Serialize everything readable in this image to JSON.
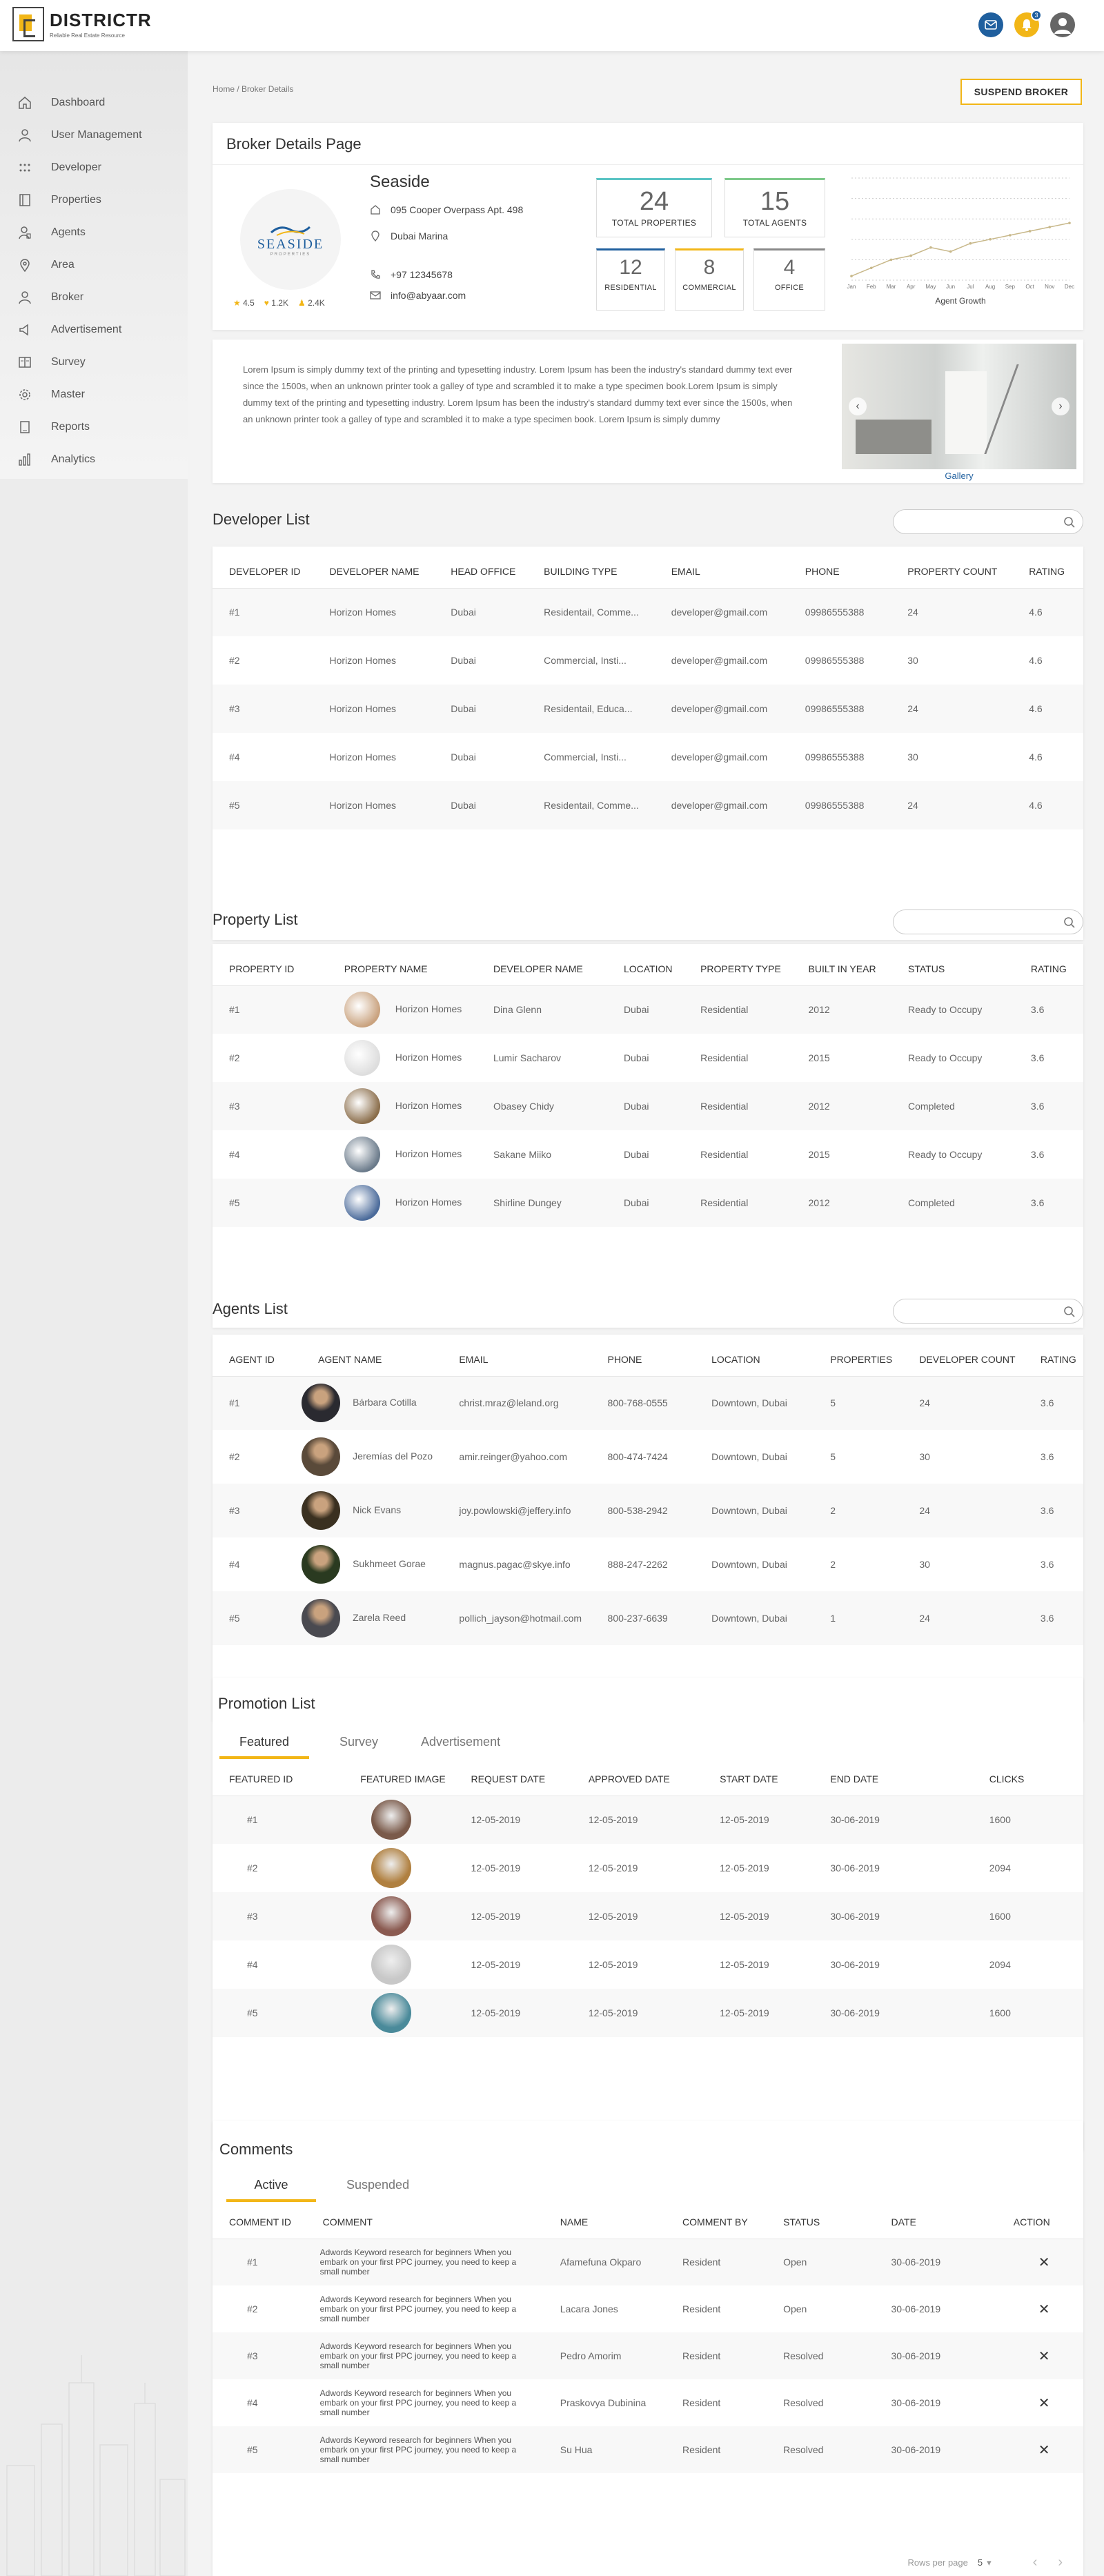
{
  "app": {
    "name": "DISTRICTR",
    "tagline": "Reliable Real Estate Resource",
    "notif_count": "3"
  },
  "nav": [
    "Dashboard",
    "User Management",
    "Developer",
    "Properties",
    "Agents",
    "Area",
    "Broker",
    "Advertisement",
    "Survey",
    "Master",
    "Reports",
    "Analytics"
  ],
  "breadcrumb": "Home / Broker Details",
  "suspend_label": "SUSPEND BROKER",
  "broker": {
    "page_title": "Broker Details Page",
    "name": "Seaside",
    "logo_text": "SEASIDE",
    "logo_sub": "PROPERTIES",
    "address": "095 Cooper Overpass Apt. 498",
    "area": "Dubai Marina",
    "phone": "+97 12345678",
    "email": "info@abyaar.com",
    "rating": "4.5",
    "likes": "1.2K",
    "followers": "2.4K",
    "stats": {
      "total_properties": {
        "value": "24",
        "label": "TOTAL PROPERTIES"
      },
      "total_agents": {
        "value": "15",
        "label": "TOTAL AGENTS"
      },
      "residential": {
        "value": "12",
        "label": "RESIDENTIAL"
      },
      "commercial": {
        "value": "8",
        "label": "COMMERCIAL"
      },
      "office": {
        "value": "4",
        "label": "OFFICE"
      }
    },
    "description": "Lorem Ipsum is simply dummy text of the printing and typesetting industry. Lorem Ipsum has been the industry's standard dummy text ever since the 1500s, when an unknown printer took a galley of type and scrambled it to make a type specimen book.Lorem Ipsum is simply dummy text of the printing and typesetting industry. Lorem Ipsum has been the industry's standard dummy text ever since the 1500s, when an unknown printer took a galley of type and scrambled it to make a type specimen book. Lorem Ipsum is simply dummy",
    "gallery_label": "Gallery"
  },
  "chart_data": {
    "type": "line",
    "title": "Agent Growth",
    "categories": [
      "Jan",
      "Feb",
      "Mar",
      "Apr",
      "May",
      "Jun",
      "Jul",
      "Aug",
      "Sep",
      "Oct",
      "Nov",
      "Dec"
    ],
    "values": [
      2,
      6,
      10,
      12,
      16,
      14,
      18,
      20,
      22,
      24,
      26,
      28
    ],
    "ylim": [
      0,
      50
    ],
    "grid": true
  },
  "developer": {
    "title": "Developer List",
    "columns": [
      "DEVELOPER ID",
      "DEVELOPER NAME",
      "HEAD OFFICE",
      "BUILDING TYPE",
      "EMAIL",
      "PHONE",
      "PROPERTY COUNT",
      "RATING"
    ],
    "rows": [
      [
        "#1",
        "Horizon Homes",
        "Dubai",
        "Residentail, Comme...",
        "developer@gmail.com",
        "09986555388",
        "24",
        "4.6"
      ],
      [
        "#2",
        "Horizon Homes",
        "Dubai",
        "Commercial, Insti...",
        "developer@gmail.com",
        "09986555388",
        "30",
        "4.6"
      ],
      [
        "#3",
        "Horizon Homes",
        "Dubai",
        "Residentail, Educa...",
        "developer@gmail.com",
        "09986555388",
        "24",
        "4.6"
      ],
      [
        "#4",
        "Horizon Homes",
        "Dubai",
        "Commercial, Insti...",
        "developer@gmail.com",
        "09986555388",
        "30",
        "4.6"
      ],
      [
        "#5",
        "Horizon Homes",
        "Dubai",
        "Residentail, Comme...",
        "developer@gmail.com",
        "09986555388",
        "24",
        "4.6"
      ]
    ]
  },
  "property": {
    "title": "Property List",
    "columns": [
      "PROPERTY ID",
      "PROPERTY NAME",
      "DEVELOPER NAME",
      "LOCATION",
      "PROPERTY TYPE",
      "BUILT IN YEAR",
      "STATUS",
      "RATING"
    ],
    "rows": [
      [
        "#1",
        "Horizon Homes",
        "Dina Glenn",
        "Dubai",
        "Residential",
        "2012",
        "Ready to Occupy",
        "3.6"
      ],
      [
        "#2",
        "Horizon Homes",
        "Lumir Sacharov",
        "Dubai",
        "Residential",
        "2015",
        "Ready to Occupy",
        "3.6"
      ],
      [
        "#3",
        "Horizon Homes",
        "Obasey Chidy",
        "Dubai",
        "Residential",
        "2012",
        "Completed",
        "3.6"
      ],
      [
        "#4",
        "Horizon Homes",
        "Sakane Miiko",
        "Dubai",
        "Residential",
        "2015",
        "Ready to Occupy",
        "3.6"
      ],
      [
        "#5",
        "Horizon Homes",
        "Shirline Dungey",
        "Dubai",
        "Residential",
        "2012",
        "Completed",
        "3.6"
      ]
    ]
  },
  "agents": {
    "title": "Agents List",
    "columns": [
      "AGENT ID",
      "AGENT NAME",
      "EMAIL",
      "PHONE",
      "LOCATION",
      "PROPERTIES",
      "DEVELOPER COUNT",
      "RATING"
    ],
    "rows": [
      [
        "#1",
        "Bárbara Cotilla",
        "christ.mraz@leland.org",
        "800-768-0555",
        "Downtown, Dubai",
        "5",
        "24",
        "3.6"
      ],
      [
        "#2",
        "Jeremías del Pozo",
        "amir.reinger@yahoo.com",
        "800-474-7424",
        "Downtown, Dubai",
        "5",
        "30",
        "3.6"
      ],
      [
        "#3",
        "Nick Evans",
        "joy.powlowski@jeffery.info",
        "800-538-2942",
        "Downtown, Dubai",
        "2",
        "24",
        "3.6"
      ],
      [
        "#4",
        "Sukhmeet Gorae",
        "magnus.pagac@skye.info",
        "888-247-2262",
        "Downtown, Dubai",
        "2",
        "30",
        "3.6"
      ],
      [
        "#5",
        "Zarela Reed",
        "pollich_jayson@hotmail.com",
        "800-237-6639",
        "Downtown, Dubai",
        "1",
        "24",
        "3.6"
      ]
    ]
  },
  "promotion": {
    "title": "Promotion List",
    "tabs": [
      "Featured",
      "Survey",
      "Advertisement"
    ],
    "columns": [
      "FEATURED ID",
      "FEATURED IMAGE",
      "REQUEST DATE",
      "APPROVED DATE",
      "START DATE",
      "END DATE",
      "CLICKS"
    ],
    "rows": [
      [
        "#1",
        "12-05-2019",
        "12-05-2019",
        "12-05-2019",
        "30-06-2019",
        "1600"
      ],
      [
        "#2",
        "12-05-2019",
        "12-05-2019",
        "12-05-2019",
        "30-06-2019",
        "2094"
      ],
      [
        "#3",
        "12-05-2019",
        "12-05-2019",
        "12-05-2019",
        "30-06-2019",
        "1600"
      ],
      [
        "#4",
        "12-05-2019",
        "12-05-2019",
        "12-05-2019",
        "30-06-2019",
        "2094"
      ],
      [
        "#5",
        "12-05-2019",
        "12-05-2019",
        "12-05-2019",
        "30-06-2019",
        "1600"
      ]
    ]
  },
  "comments": {
    "title": "Comments",
    "tabs": [
      "Active",
      "Suspended"
    ],
    "columns": [
      "COMMENT ID",
      "COMMENT",
      "NAME",
      "COMMENT BY",
      "STATUS",
      "DATE",
      "ACTION"
    ],
    "comment_text": "Adwords Keyword research for beginners When you embark on your first PPC journey, you need to keep a small number",
    "rows": [
      [
        "#1",
        "Afamefuna Okparo",
        "Resident",
        "Open",
        "30-06-2019"
      ],
      [
        "#2",
        "Lacara Jones",
        "Resident",
        "Open",
        "30-06-2019"
      ],
      [
        "#3",
        "Pedro Amorim",
        "Resident",
        "Resolved",
        "30-06-2019"
      ],
      [
        "#4",
        "Praskovya Dubinina",
        "Resident",
        "Resolved",
        "30-06-2019"
      ],
      [
        "#5",
        "Su Hua",
        "Resident",
        "Resolved",
        "30-06-2019"
      ]
    ]
  },
  "pager": {
    "rows_label": "Rows per page",
    "rows_value": "5"
  },
  "colors": {
    "accent": "#f2b617",
    "primary": "#1f5f9e"
  }
}
